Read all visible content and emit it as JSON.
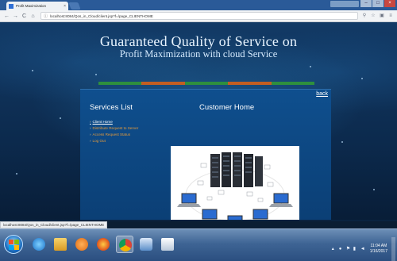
{
  "browser": {
    "tab_title": "Profit Maximization",
    "tab_close": "×",
    "url": "localhost:8084/Qos_in_Cloud/client.jsp?f=/page_CLIENTHOME",
    "back": "←",
    "forward": "→",
    "reload": "C",
    "home": "⌂",
    "info": "ⓘ",
    "window_controls": [
      "–",
      "□",
      "×"
    ]
  },
  "page": {
    "title": "Guaranteed Quality of Service on",
    "subtitle": "Profit Maximization with cloud Service",
    "menu_strip_colors": [
      "#2e8f3e",
      "#c25e22",
      "#2e8f3e",
      "#c25e22",
      "#2e8f3e"
    ],
    "back_link": "back",
    "sidebar": {
      "title": "Services List",
      "items": [
        {
          "label": "Client Home",
          "active": true
        },
        {
          "label": "Distribute Request to Server",
          "active": false
        },
        {
          "label": "Access Request Status",
          "active": false
        },
        {
          "label": "Log Out",
          "active": false
        }
      ]
    },
    "main": {
      "title": "Customer Home",
      "illustration": "cloud-server-network-illustration"
    }
  },
  "status_bar": {
    "url": "localhost:8084/Qos_in_Cloud/client.jsp?f=/page_CLIENTHOME"
  },
  "taskbar": {
    "apps": [
      "internet-explorer-icon",
      "file-explorer-icon",
      "media-player-icon",
      "firefox-icon",
      "chrome-icon",
      "virtualbox-icon",
      "notepad-icon"
    ],
    "clock": {
      "time": "11:04 AM",
      "date": "1/16/2017"
    },
    "tray_icons": [
      "up-arrow-icon",
      "network-icon",
      "flag-icon",
      "signal-icon",
      "volume-icon"
    ]
  },
  "colors": {
    "accent_orange": "#e79b3a",
    "content_blue": "#0f4f8e"
  }
}
